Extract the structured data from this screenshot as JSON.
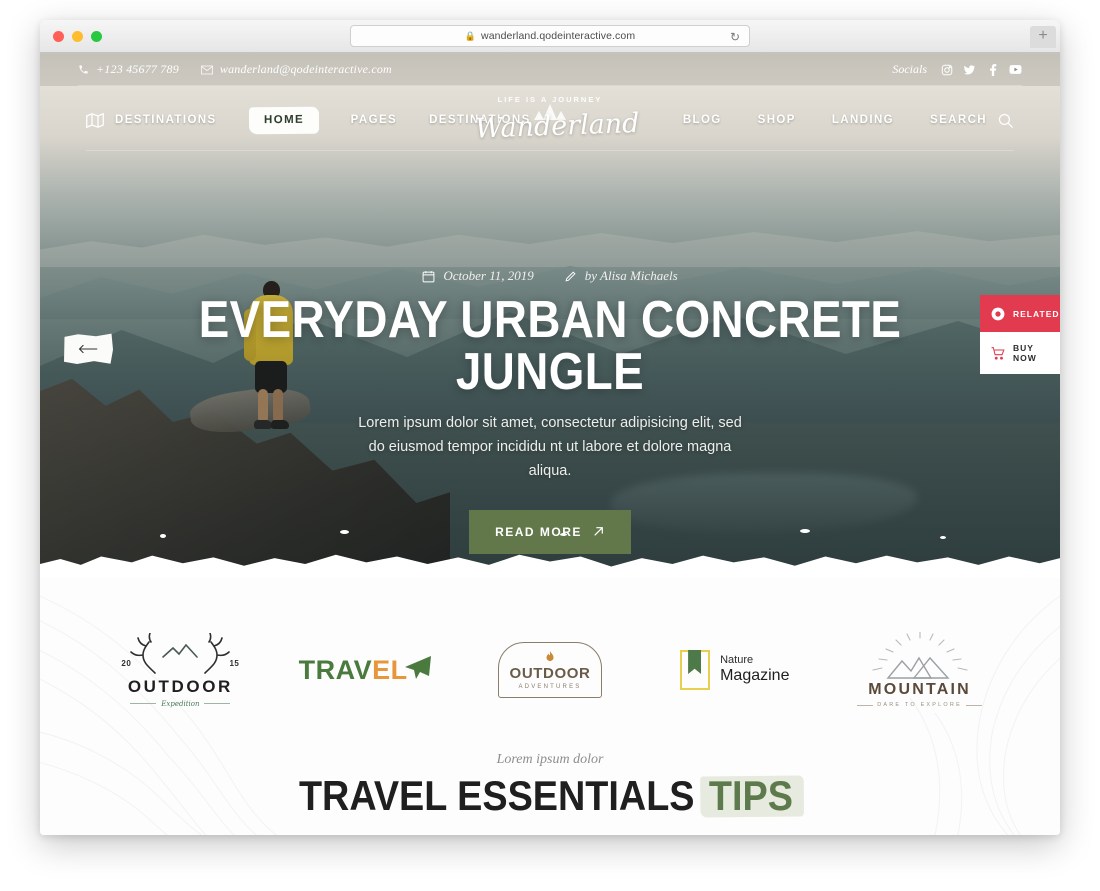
{
  "browser": {
    "url": "wanderland.qodeinteractive.com",
    "lock_icon": "lock-icon",
    "reload_icon": "reload-icon",
    "new_tab_label": "+",
    "traffic_lights": [
      "close",
      "minimize",
      "zoom"
    ]
  },
  "topbar": {
    "phone": "+123 45677 789",
    "email": "wanderland@qodeinteractive.com",
    "socials_label": "Socials",
    "socials": [
      {
        "name": "instagram-icon",
        "glyph": ""
      },
      {
        "name": "twitter-icon",
        "glyph": ""
      },
      {
        "name": "facebook-icon",
        "glyph": "f"
      },
      {
        "name": "youtube-icon",
        "glyph": ""
      }
    ]
  },
  "nav": {
    "map_icon": "map-icon",
    "left": [
      "DESTINATIONS",
      "HOME",
      "PAGES",
      "DESTINATIONS"
    ],
    "active": "HOME",
    "right": [
      "BLOG",
      "SHOP",
      "LANDING"
    ],
    "search_label": "SEARCH",
    "search_icon": "search-icon"
  },
  "logo": {
    "tagline": "LIFE IS A JOURNEY",
    "name": "Wanderland"
  },
  "hero": {
    "date": "October 11, 2019",
    "date_icon": "calendar-icon",
    "author": "by Alisa Michaels",
    "author_icon": "pencil-icon",
    "title": "EVERYDAY URBAN CONCRETE JUNGLE",
    "subtitle": "Lorem ipsum dolor sit amet, consectetur adipisicing elit, sed do eiusmod tempor incididu nt ut labore et dolore magna aliqua.",
    "cta_label": "READ MORE",
    "cta_icon": "arrow-up-right-icon",
    "cta_color": "#62784b",
    "prev_icon": "arrow-left-icon"
  },
  "side_widgets": [
    {
      "label": "RELATED",
      "icon": "record-circle-icon",
      "color": "#e23a4e"
    },
    {
      "label": "BUY NOW",
      "icon": "cart-icon",
      "color": "#ffffff"
    }
  ],
  "clients": [
    {
      "name": "outdoor-expedition-logo",
      "word": "OUTDOOR",
      "sub": "Expedition",
      "year_left": "20",
      "year_right": "15"
    },
    {
      "name": "travel-logo",
      "word_a": "TRAV",
      "word_b": "EL",
      "icon": "paper-plane-icon"
    },
    {
      "name": "outdoor-adventures-logo",
      "word": "OUTDOOR",
      "sub": "ADVENTURES",
      "icon": "campfire-icon"
    },
    {
      "name": "nature-magazine-logo",
      "line1": "Nature",
      "line2": "Magazine",
      "icon": "bookmark-icon"
    },
    {
      "name": "mountain-logo",
      "word": "MOUNTAIN",
      "sub": "DARE TO EXPLORE",
      "icon": "sunburst-mountain-icon"
    }
  ],
  "section": {
    "pretitle": "Lorem ipsum dolor",
    "title_main": "TRAVEL ESSENTIALS",
    "title_highlight": "TIPS",
    "highlight_color": "#5d7a4d"
  }
}
